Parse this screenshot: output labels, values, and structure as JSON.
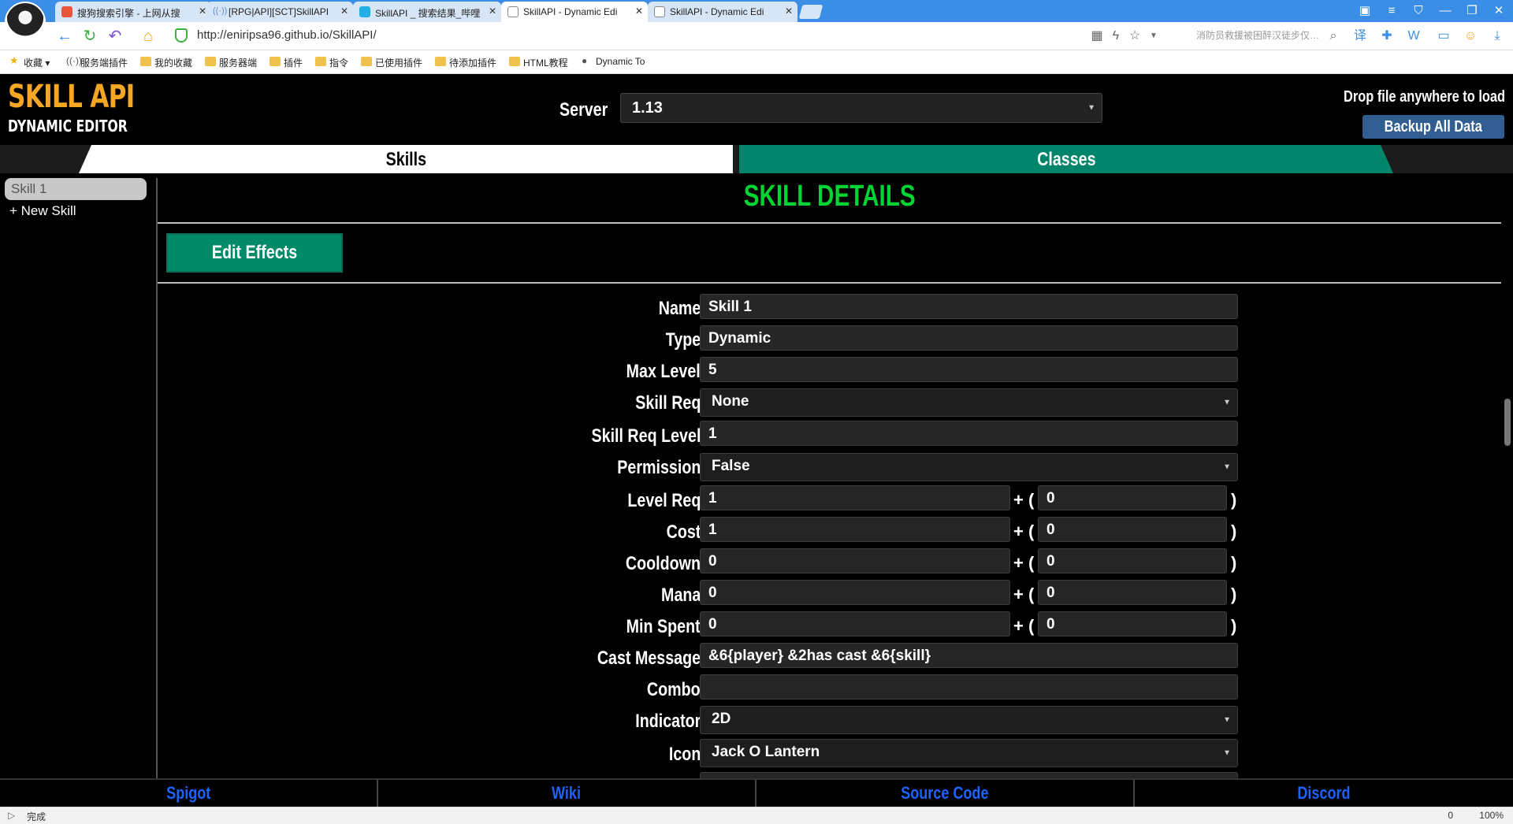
{
  "browser": {
    "tabs": [
      {
        "label": "搜狗搜索引擎 - 上网从搜",
        "favicon_color": "#e8553b"
      },
      {
        "label": "[RPG|API][SCT]SkillAPI",
        "favicon_color": "#5b8fd6"
      },
      {
        "label": "SkillAPI _ 搜索结果_哔哩",
        "favicon_color": "#23ade5"
      },
      {
        "label": "SkillAPI - Dynamic Edi",
        "favicon_color": "#888888"
      },
      {
        "label": "SkillAPI - Dynamic Edi",
        "favicon_color": "#888888"
      }
    ],
    "url": "http://eniripsa96.github.io/SkillAPI/",
    "search_placeholder": "消防员救援被困醉汉徒步仅…",
    "bookmarks": [
      "收藏",
      "服务端插件",
      "我的收藏",
      "服务器端",
      "插件",
      "指令",
      "已使用插件",
      "待添加插件",
      "HTML教程",
      "Dynamic To"
    ],
    "status": "完成",
    "blocked_count": "0",
    "zoom": "100%"
  },
  "header": {
    "logo_title": "SKILL API",
    "logo_subtitle": "DYNAMIC EDITOR",
    "server_label": "Server",
    "server_value": "1.13",
    "drop_text": "Drop file anywhere to load",
    "backup_label": "Backup All Data"
  },
  "main_tabs": {
    "skills": "Skills",
    "classes": "Classes"
  },
  "sidebar": {
    "selected_skill": "Skill 1",
    "new_skill": "+ New Skill"
  },
  "details": {
    "title": "SKILL DETAILS",
    "edit_effects": "Edit Effects",
    "fields": {
      "name": {
        "label": "Name",
        "value": "Skill 1"
      },
      "type": {
        "label": "Type",
        "value": "Dynamic"
      },
      "max_level": {
        "label": "Max Level",
        "value": "5"
      },
      "skill_req": {
        "label": "Skill Req",
        "value": "None"
      },
      "skill_req_level": {
        "label": "Skill Req Level",
        "value": "1"
      },
      "permission": {
        "label": "Permission",
        "value": "False"
      },
      "level_req": {
        "label": "Level Req",
        "base": "1",
        "scale": "0"
      },
      "cost": {
        "label": "Cost",
        "base": "1",
        "scale": "0"
      },
      "cooldown": {
        "label": "Cooldown",
        "base": "0",
        "scale": "0"
      },
      "mana": {
        "label": "Mana",
        "base": "0",
        "scale": "0"
      },
      "min_spent": {
        "label": "Min Spent",
        "base": "0",
        "scale": "0"
      },
      "cast_message": {
        "label": "Cast Message",
        "value": "&6{player} &2has cast &6{skill}"
      },
      "combo": {
        "label": "Combo",
        "value": ""
      },
      "indicator": {
        "label": "Indicator",
        "value": "2D"
      },
      "icon": {
        "label": "Icon",
        "value": "Jack O Lantern"
      }
    },
    "plus_open": "+ (",
    "close": ")"
  },
  "footer": {
    "links": [
      "Spigot",
      "Wiki",
      "Source Code",
      "Discord"
    ]
  },
  "colors": {
    "title_green": "#00d433",
    "logo_orange": "#f5a623",
    "classes_teal": "#00856a",
    "footer_link_blue": "#1e63ff",
    "backup_blue": "#325d91"
  }
}
